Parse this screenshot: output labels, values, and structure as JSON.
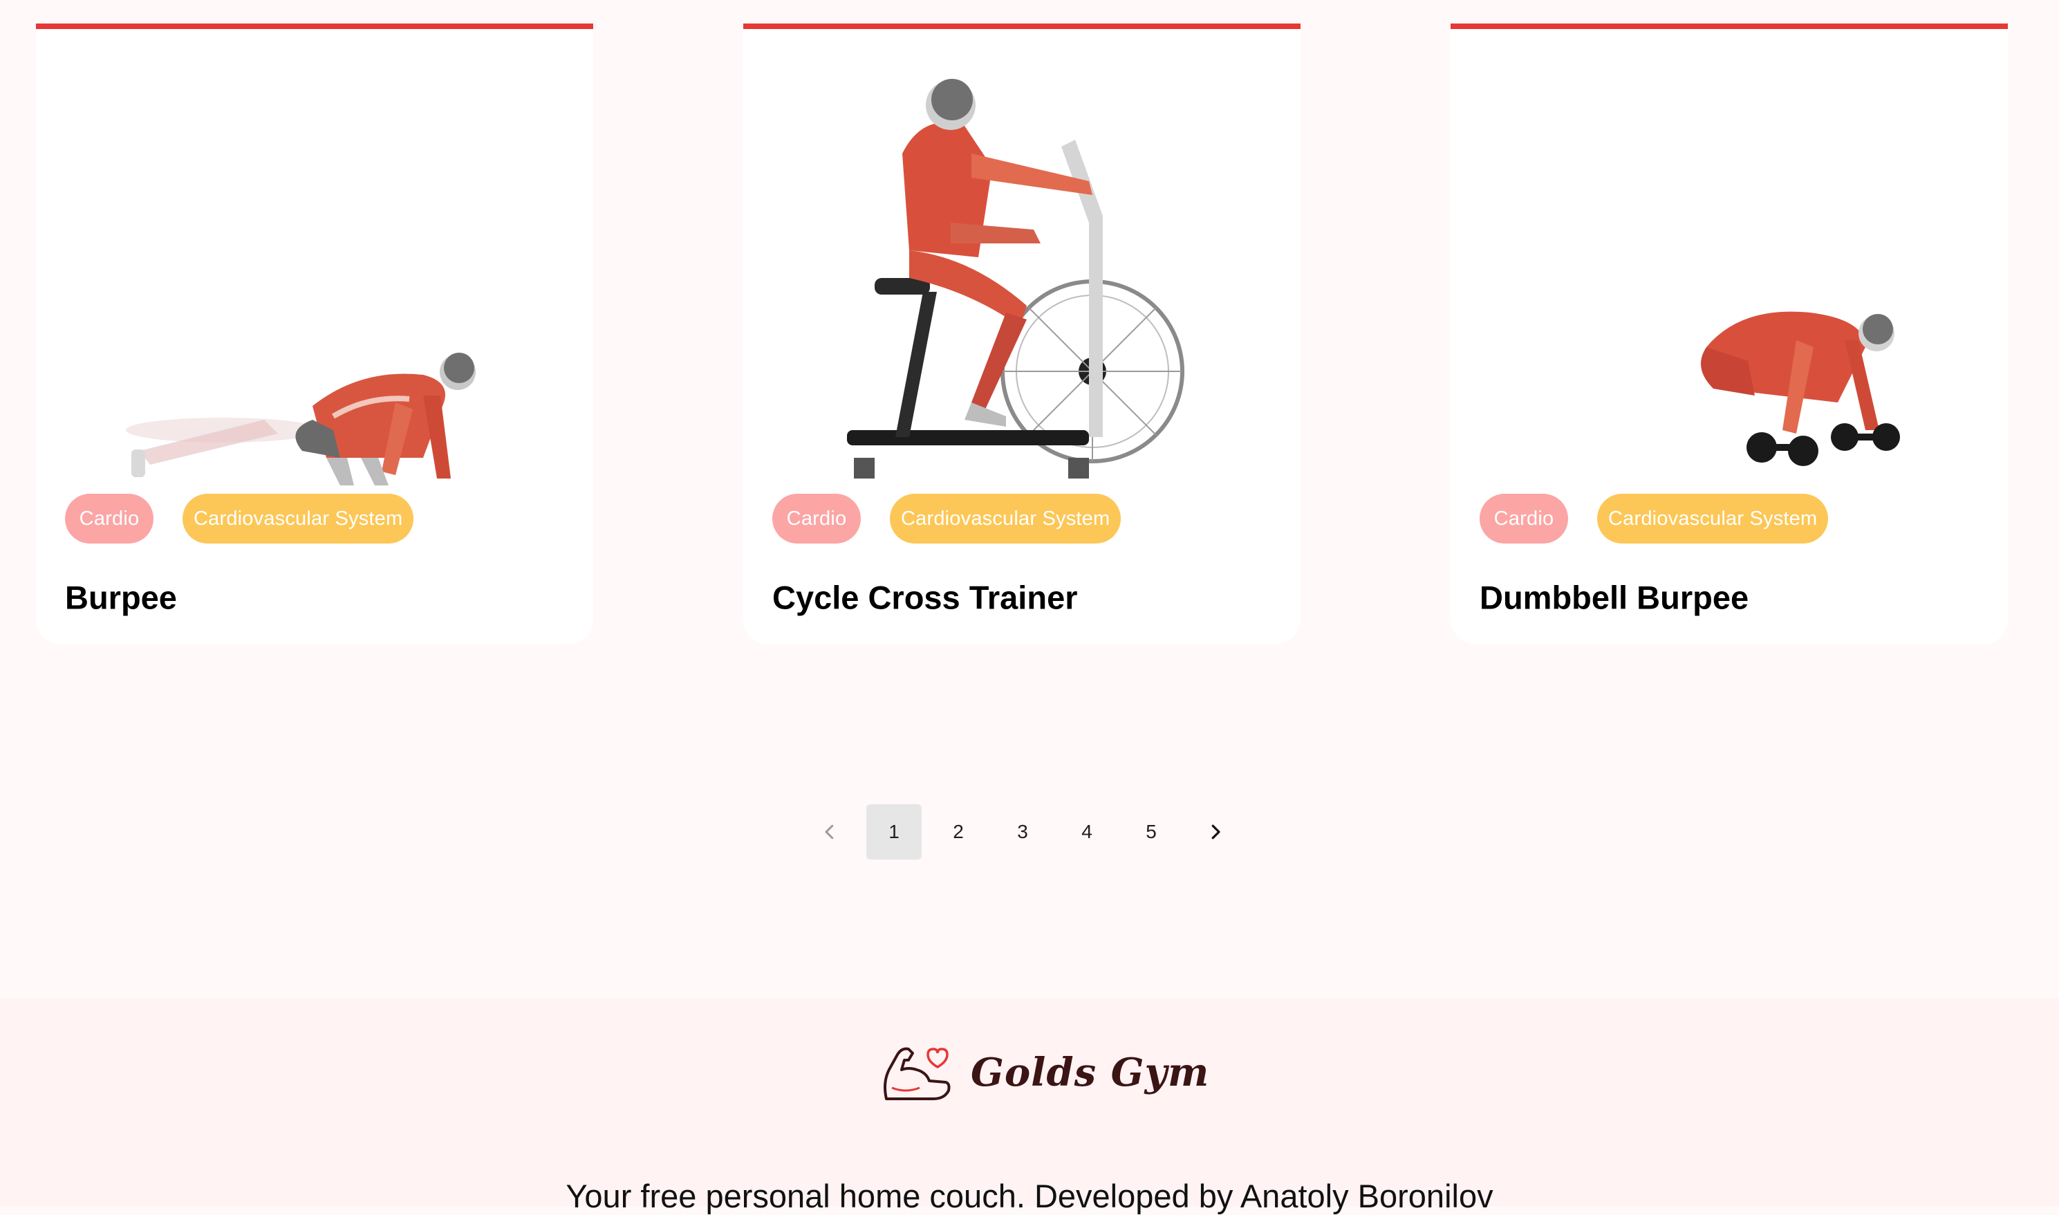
{
  "exercises": [
    {
      "name": "Burpee",
      "body_part": "Cardio",
      "target": "Cardiovascular System",
      "image_icon": "burpee-illustration"
    },
    {
      "name": "Cycle Cross Trainer",
      "body_part": "Cardio",
      "target": "Cardiovascular System",
      "image_icon": "cycle-cross-trainer-illustration"
    },
    {
      "name": "Dumbbell Burpee",
      "body_part": "Cardio",
      "target": "Cardiovascular System",
      "image_icon": "dumbbell-burpee-illustration"
    }
  ],
  "pagination": {
    "prev_icon": "chevron-left-icon",
    "next_icon": "chevron-right-icon",
    "pages": [
      "1",
      "2",
      "3",
      "4",
      "5"
    ],
    "current_page": "1"
  },
  "footer": {
    "logo_text": "Golds Gym",
    "logo_icon": "flexed-arm-heart-icon",
    "tagline": "Your free personal home couch. Developed by Anatoly Boronilov"
  },
  "colors": {
    "accent": "#e53935",
    "tag_body_part": "#fca5a5",
    "tag_target": "#fcc757",
    "page_bg": "#fff9f9",
    "footer_bg": "#fff3f4"
  }
}
